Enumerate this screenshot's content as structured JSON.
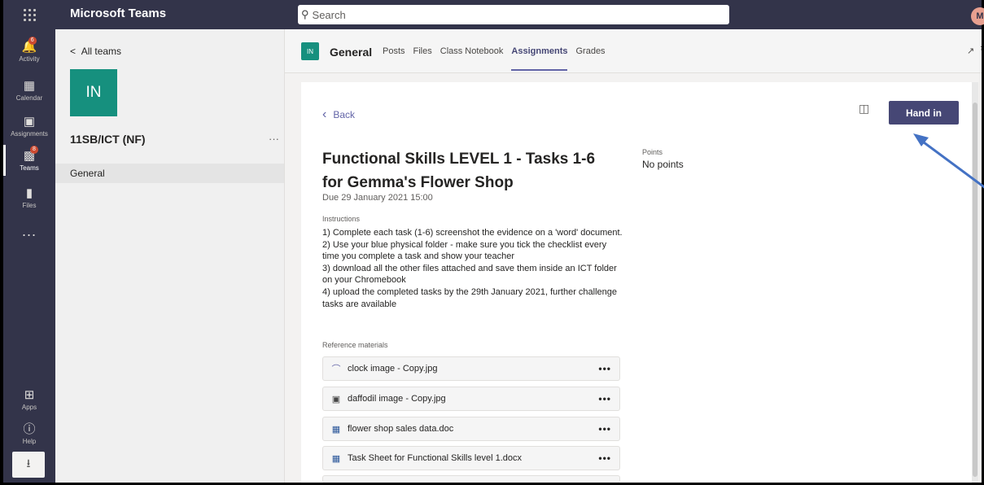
{
  "app": {
    "title": "Microsoft Teams",
    "avatar_initial": "M"
  },
  "search": {
    "placeholder": "Search"
  },
  "rail": {
    "items": [
      {
        "label": "Activity",
        "icon": "bell-icon",
        "badge": "6"
      },
      {
        "label": "Calendar",
        "icon": "calendar-icon"
      },
      {
        "label": "Assignments",
        "icon": "assignments-icon"
      },
      {
        "label": "Teams",
        "icon": "teams-icon",
        "badge": "8"
      },
      {
        "label": "Files",
        "icon": "file-icon"
      }
    ],
    "more": "...",
    "bottom": [
      {
        "label": "Apps",
        "icon": "apps-icon"
      },
      {
        "label": "Help",
        "icon": "help-icon"
      }
    ]
  },
  "team_panel": {
    "back_label": "All teams",
    "tile_initials": "IN",
    "team_name": "11SB/ICT (NF)",
    "more": "···",
    "channels": [
      {
        "label": "General"
      }
    ]
  },
  "header": {
    "channel_initials": "IN",
    "channel_name": "General",
    "tabs": [
      "Posts",
      "Files",
      "Class Notebook",
      "Assignments",
      "Grades"
    ],
    "active_tab": "Assignments"
  },
  "assignment": {
    "back_label": "Back",
    "hand_in_label": "Hand in",
    "title": "Functional Skills LEVEL 1 - Tasks 1-6 for Gemma's Flower Shop",
    "due": "Due 29 January 2021 15:00",
    "points_label": "Points",
    "points_value": "No points",
    "instructions_label": "Instructions",
    "instructions": [
      "1) Complete each task (1-6) screenshot the evidence on a 'word' document.",
      "2) Use your blue physical folder - make sure you tick the checklist every time you complete a task and show your teacher",
      "3) download all the other files attached and save them inside an ICT folder on your Chromebook",
      "4) upload the completed tasks by the 29th January 2021, further challenge tasks are available"
    ],
    "reference_label": "Reference materials",
    "references": [
      {
        "name": "clock image - Copy.jpg",
        "icon": "loading-spinner-icon",
        "more": "•••"
      },
      {
        "name": "daffodil image - Copy.jpg",
        "icon": "image-icon",
        "more": "•••"
      },
      {
        "name": "flower shop sales data.doc",
        "icon": "word-doc-icon",
        "more": "•••"
      },
      {
        "name": "Task Sheet for Functional Skills level 1.docx",
        "icon": "word-doc-icon",
        "more": "•••"
      }
    ]
  },
  "colors": {
    "brand": "#464775",
    "accent": "#6264a7",
    "team_tile": "#16907e",
    "rail": "#33344a",
    "arrow": "#4472c4"
  }
}
